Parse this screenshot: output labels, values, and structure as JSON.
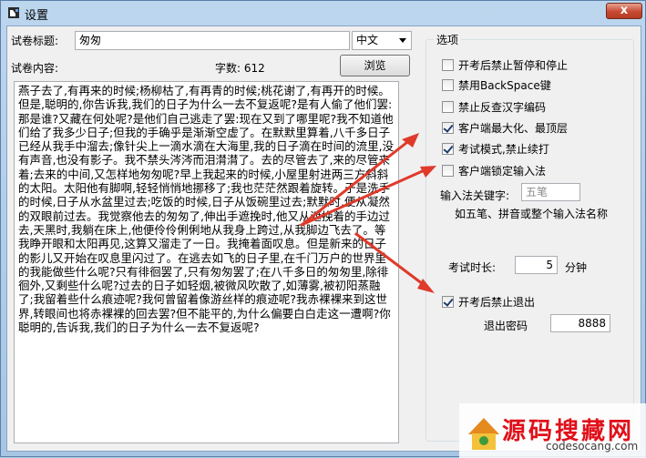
{
  "window": {
    "title": "设置",
    "close_glyph": "x"
  },
  "form": {
    "title_label": "试卷标题:",
    "title_value": "匆匆",
    "language_value": "中文",
    "content_label": "试卷内容:",
    "char_count_label": "字数: 612",
    "browse_button": "浏览",
    "content_text": "燕子去了,有再来的时候;杨柳枯了,有再青的时候;桃花谢了,有再开的时候。但是,聪明的,你告诉我,我们的日子为什么一去不复返呢?是有人偷了他们罢:那是谁?又藏在何处呢?是他们自己逃走了罢:现在又到了哪里呢?我不知道他们给了我多少日子;但我的手确乎是渐渐空虚了。在默默里算着,八千多日子已经从我手中溜去;像针尖上一滴水滴在大海里,我的日子滴在时间的流里,没有声音,也没有影子。我不禁头涔涔而泪潸潸了。去的尽管去了,来的尽管来着;去来的中间,又怎样地匆匆呢?早上我起来的时候,小屋里射进两三方斜斜的太阳。太阳他有脚啊,轻轻悄悄地挪移了;我也茫茫然跟着旋转。于是洗手的时候,日子从水盆里过去;吃饭的时候,日子从饭碗里过去;默默时,便从凝然的双眼前过去。我觉察他去的匆匆了,伸出手遮挽时,他又从遮挽着的手边过去,天黑时,我躺在床上,他便伶伶俐俐地从我身上跨过,从我脚边飞去了。等我睁开眼和太阳再见,这算又溜走了一日。我掩着面叹息。但是新来的日子的影儿又开始在叹息里闪过了。在逃去如飞的日子里,在千门万户的世界里的我能做些什么呢?只有徘徊罢了,只有匆匆罢了;在八千多日的匆匆里,除徘徊外,又剩些什么呢?过去的日子如轻烟,被微风吹散了,如薄雾,被初阳蒸融了;我留着些什么痕迹呢?我何曾留着像游丝样的痕迹呢?我赤裸裸来到这世界,转眼间也将赤裸裸的回去罢?但不能平的,为什么偏要白白走这一遭啊?你聪明的,告诉我,我们的日子为什么一去不复返呢?"
  },
  "options": {
    "group_title": "选项",
    "items": [
      {
        "label": "开考后禁止暂停和停止",
        "checked": false
      },
      {
        "label": "禁用BackSpace键",
        "checked": false
      },
      {
        "label": "禁止反查汉字编码",
        "checked": false
      },
      {
        "label": "客户端最大化、最顶层",
        "checked": true
      },
      {
        "label": "考试模式,禁止续打",
        "checked": true
      },
      {
        "label": "客户端锁定输入法",
        "checked": false
      }
    ],
    "ime_keyword_label": "输入法关键字:",
    "ime_keyword_placeholder": "五笔",
    "ime_hint": "如五笔、拼音或整个输入法名称",
    "exam_time_label": "考试时长:",
    "exam_time_value": "5",
    "exam_time_unit": "分钟",
    "no_exit_label": "开考后禁止退出",
    "no_exit_checked": true,
    "exit_password_label": "退出密码",
    "exit_password_value": "8888"
  },
  "watermark": {
    "text": "源码搜藏网",
    "url": "codesocang.com"
  },
  "colors": {
    "arrow": "#e03a2a",
    "window_frame": "#a6c6e4",
    "watermark_red": "#e0101a"
  }
}
